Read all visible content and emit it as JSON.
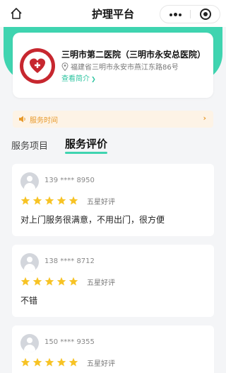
{
  "header": {
    "title": "护理平台"
  },
  "hospital": {
    "name": "三明市第二医院（三明市永安总医院）",
    "address": "福建省三明市永安市燕江东路86号",
    "intro_link": "查看简介",
    "intro_arrow": "❯"
  },
  "service_time": {
    "label": "服务时间",
    "arrow": "›"
  },
  "tabs": [
    {
      "label": "服务项目"
    },
    {
      "label": "服务评价"
    }
  ],
  "reviews": [
    {
      "phone": "139 **** 8950",
      "stars": 5,
      "rating_text": "五星好评",
      "comment": "对上门服务很满意，不用出门，很方便"
    },
    {
      "phone": "138 **** 8712",
      "stars": 5,
      "rating_text": "五星好评",
      "comment": "不错"
    },
    {
      "phone": "150 **** 9355",
      "stars": 5,
      "rating_text": "五星好评",
      "comment": ""
    }
  ],
  "colors": {
    "accent": "#3fd4b0",
    "star": "#f7c325",
    "notice_text": "#e89a2c",
    "logo_red": "#c7272f"
  },
  "icons": [
    "home-icon",
    "more-icon",
    "close-target-icon",
    "location-pin-icon",
    "speaker-icon",
    "star-icon",
    "avatar-icon"
  ]
}
